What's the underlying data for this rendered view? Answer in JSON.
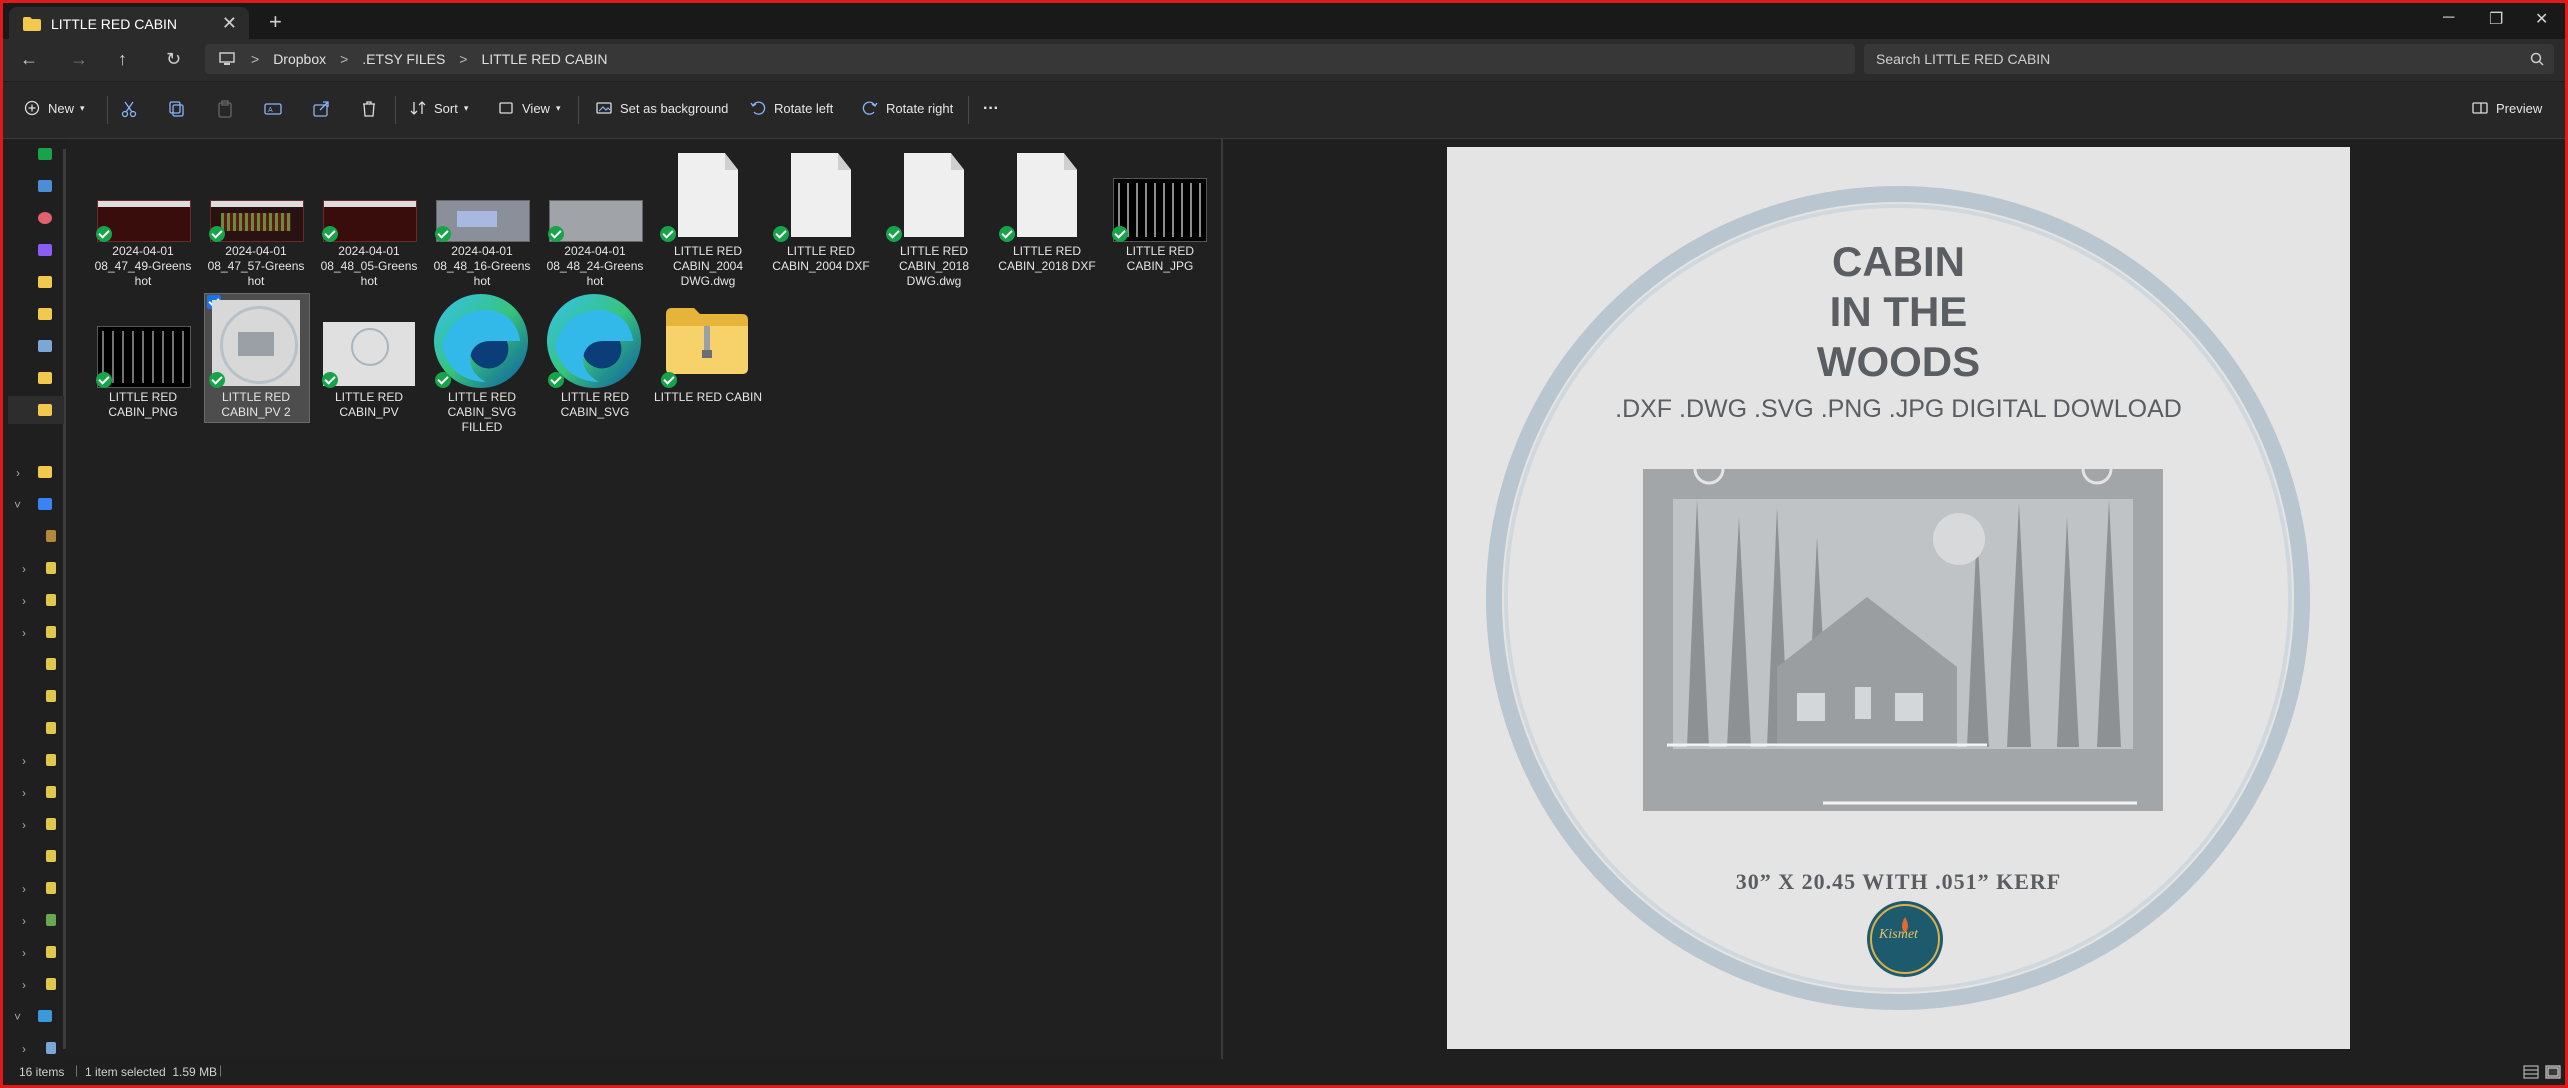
{
  "window": {
    "tab_title": "LITTLE RED CABIN",
    "close_tab": "✕",
    "new_tab": "+",
    "minimize": "─",
    "maximize": "❐",
    "close": "✕"
  },
  "nav": {
    "back": "←",
    "forward": "→",
    "up": "↑",
    "refresh": "↻",
    "breadcrumb": [
      "Dropbox",
      ".ETSY FILES",
      "LITTLE RED CABIN"
    ],
    "separator": ">",
    "search_placeholder": "Search LITTLE RED CABIN"
  },
  "toolbar": {
    "new_label": "New",
    "sort_label": "Sort",
    "view_label": "View",
    "set_background_label": "Set as background",
    "rotate_left_label": "Rotate left",
    "rotate_right_label": "Rotate right",
    "more_label": "···",
    "preview_label": "Preview"
  },
  "files": [
    {
      "name": "2024-04-01 08_47_49-Greens hot",
      "type": "screenshot-red"
    },
    {
      "name": "2024-04-01 08_47_57-Greens hot",
      "type": "screenshot-red2"
    },
    {
      "name": "2024-04-01 08_48_05-Greens hot",
      "type": "screenshot-red3"
    },
    {
      "name": "2024-04-01 08_48_16-Greens hot",
      "type": "screenshot-grey"
    },
    {
      "name": "2024-04-01 08_48_24-Greens hot",
      "type": "screenshot-grey2"
    },
    {
      "name": "LITTLE RED CABIN_2004 DWG.dwg",
      "type": "document"
    },
    {
      "name": "LITTLE RED CABIN_2004 DXF",
      "type": "document"
    },
    {
      "name": "LITTLE RED CABIN_2018 DWG.dwg",
      "type": "document"
    },
    {
      "name": "LITTLE RED CABIN_2018 DXF",
      "type": "document"
    },
    {
      "name": "LITTLE RED CABIN_JPG",
      "type": "image-bw"
    },
    {
      "name": "LITTLE RED CABIN_PNG",
      "type": "image-bw"
    },
    {
      "name": "LITTLE RED CABIN_PV 2",
      "type": "image-pv",
      "selected": true
    },
    {
      "name": "LITTLE RED CABIN_PV",
      "type": "image-pv"
    },
    {
      "name": "LITTLE RED CABIN_SVG FILLED",
      "type": "edge-icon"
    },
    {
      "name": "LITTLE RED CABIN_SVG",
      "type": "edge-icon"
    },
    {
      "name": "LITTLE RED CABIN",
      "type": "zip-folder"
    }
  ],
  "preview_image": {
    "title_lines": [
      "CABIN",
      "IN THE",
      "WOODS"
    ],
    "formats": ".DXF .DWG .SVG .PNG .JPG DIGITAL DOWLOAD",
    "dimensions": "30” X 20.45 WITH .051” KERF",
    "logo_text": "Kismet"
  },
  "status": {
    "items": "16 items",
    "selection": "1 item selected  1.59 MB"
  },
  "colors": {
    "accent_border": "#e0191a",
    "sync_check": "#16a34a",
    "selection_check": "#1a73e8",
    "folder_yellow": "#f2c94c"
  }
}
